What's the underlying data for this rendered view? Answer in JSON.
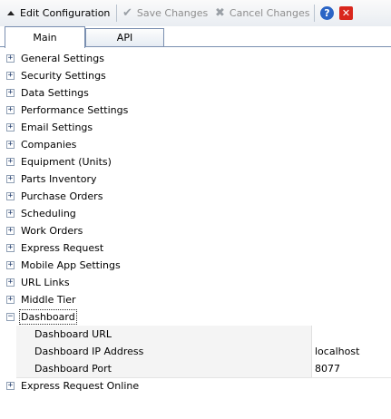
{
  "toolbar": {
    "edit_label": "Edit Configuration",
    "save_label": "Save Changes",
    "cancel_label": "Cancel Changes",
    "help_icon": "help-icon",
    "close_icon": "close-icon",
    "colors": {
      "help": "#2a64c5",
      "close": "#d9261c",
      "disabled_text": "#8e8e8e"
    }
  },
  "tabs": [
    {
      "label": "Main",
      "active": true
    },
    {
      "label": "API",
      "active": false
    }
  ],
  "tree": {
    "items": [
      {
        "label": "General Settings",
        "expanded": false
      },
      {
        "label": "Security Settings",
        "expanded": false
      },
      {
        "label": "Data Settings",
        "expanded": false
      },
      {
        "label": "Performance Settings",
        "expanded": false
      },
      {
        "label": "Email Settings",
        "expanded": false
      },
      {
        "label": "Companies",
        "expanded": false
      },
      {
        "label": "Equipment (Units)",
        "expanded": false
      },
      {
        "label": "Parts Inventory",
        "expanded": false
      },
      {
        "label": "Purchase Orders",
        "expanded": false
      },
      {
        "label": "Scheduling",
        "expanded": false
      },
      {
        "label": "Work Orders",
        "expanded": false
      },
      {
        "label": "Express Request",
        "expanded": false
      },
      {
        "label": "Mobile App Settings",
        "expanded": false
      },
      {
        "label": "URL Links",
        "expanded": false
      },
      {
        "label": "Middle Tier",
        "expanded": false
      },
      {
        "label": "Dashboard",
        "expanded": true
      },
      {
        "label": "Express Request Online",
        "expanded": false
      }
    ],
    "dashboard_properties": [
      {
        "name": "Dashboard URL",
        "value": ""
      },
      {
        "name": "Dashboard IP Address",
        "value": "localhost"
      },
      {
        "name": "Dashboard Port",
        "value": "8077"
      }
    ]
  }
}
